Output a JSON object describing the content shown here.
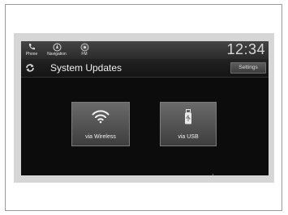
{
  "topbar": {
    "buttons": [
      {
        "label": "Phone",
        "icon": "phone-icon"
      },
      {
        "label": "Navigation",
        "icon": "navigation-icon"
      },
      {
        "label": "FM",
        "icon": "radio-icon"
      }
    ],
    "clock": "12:34"
  },
  "header": {
    "title": "System Updates",
    "settings_label": "Settings",
    "refresh_icon": "refresh-icon"
  },
  "options": [
    {
      "label": "via Wireless",
      "icon": "wifi-icon"
    },
    {
      "label": "via USB",
      "icon": "usb-drive-icon"
    }
  ],
  "colors": {
    "screen_background": "#0c0c0c",
    "tile_background": "#555555",
    "text": "#f0f0f0",
    "bezel": "#d6d6d6"
  }
}
